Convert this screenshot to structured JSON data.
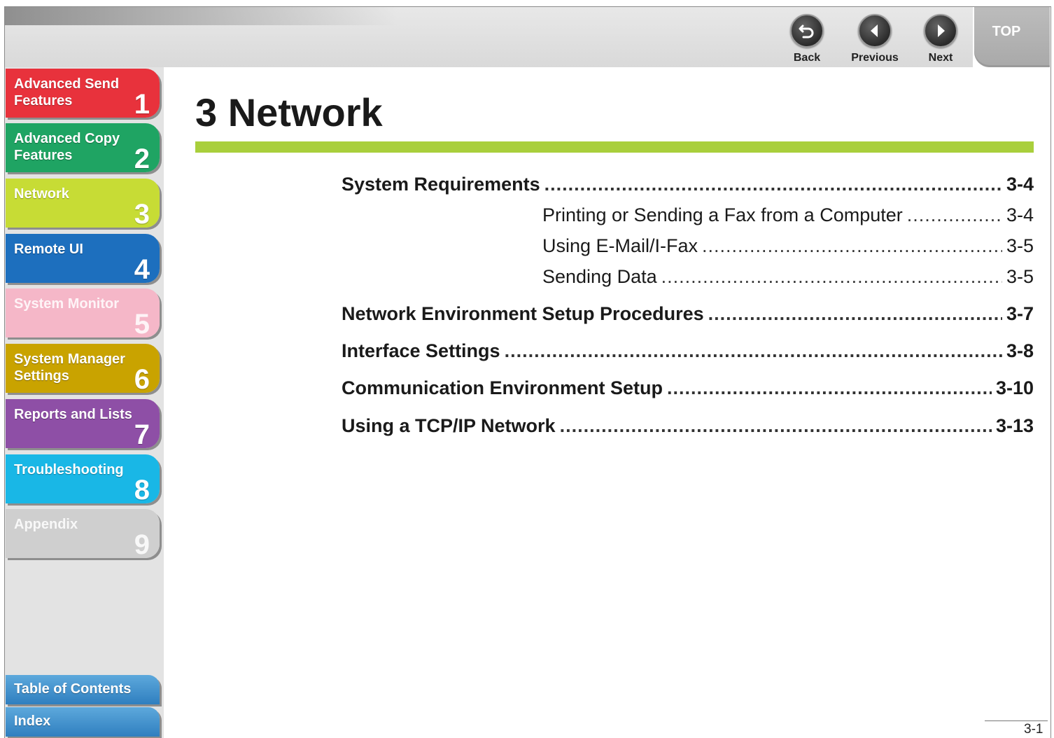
{
  "nav": {
    "back": "Back",
    "previous": "Previous",
    "next": "Next",
    "top": "TOP"
  },
  "sidebar": {
    "tabs": [
      {
        "label": "Advanced Send Features",
        "num": "1",
        "color": "#e8323c"
      },
      {
        "label": "Advanced Copy Features",
        "num": "2",
        "color": "#1fa463"
      },
      {
        "label": "Network",
        "num": "3",
        "color": "#c7dc35"
      },
      {
        "label": "Remote UI",
        "num": "4",
        "color": "#1d6fbe"
      },
      {
        "label": "System Monitor",
        "num": "5",
        "color": "#f5b7c8"
      },
      {
        "label": "System Manager Settings",
        "num": "6",
        "color": "#c9a300"
      },
      {
        "label": "Reports and Lists",
        "num": "7",
        "color": "#8e4fa6"
      },
      {
        "label": "Troubleshooting",
        "num": "8",
        "color": "#19b7e6"
      },
      {
        "label": "Appendix",
        "num": "9",
        "color": "#cfcfcf"
      }
    ],
    "table_of_contents": "Table of Contents",
    "index": "Index"
  },
  "main": {
    "title": "3 Network",
    "accent_color": "#a9cf3c",
    "toc": [
      {
        "title": "System Requirements",
        "page": "3-4",
        "level": 1
      },
      {
        "title": "Printing or Sending a Fax from a Computer",
        "page": "3-4",
        "level": 2
      },
      {
        "title": "Using E-Mail/I-Fax",
        "page": "3-5",
        "level": 2
      },
      {
        "title": "Sending Data",
        "page": "3-5",
        "level": 2
      },
      {
        "title": "Network Environment Setup Procedures",
        "page": "3-7",
        "level": 1
      },
      {
        "title": "Interface Settings",
        "page": "3-8",
        "level": 1
      },
      {
        "title": "Communication Environment Setup",
        "page": "3-10",
        "level": 1
      },
      {
        "title": "Using a TCP/IP Network",
        "page": "3-13",
        "level": 1
      }
    ]
  },
  "footer": {
    "page_number": "3-1"
  }
}
